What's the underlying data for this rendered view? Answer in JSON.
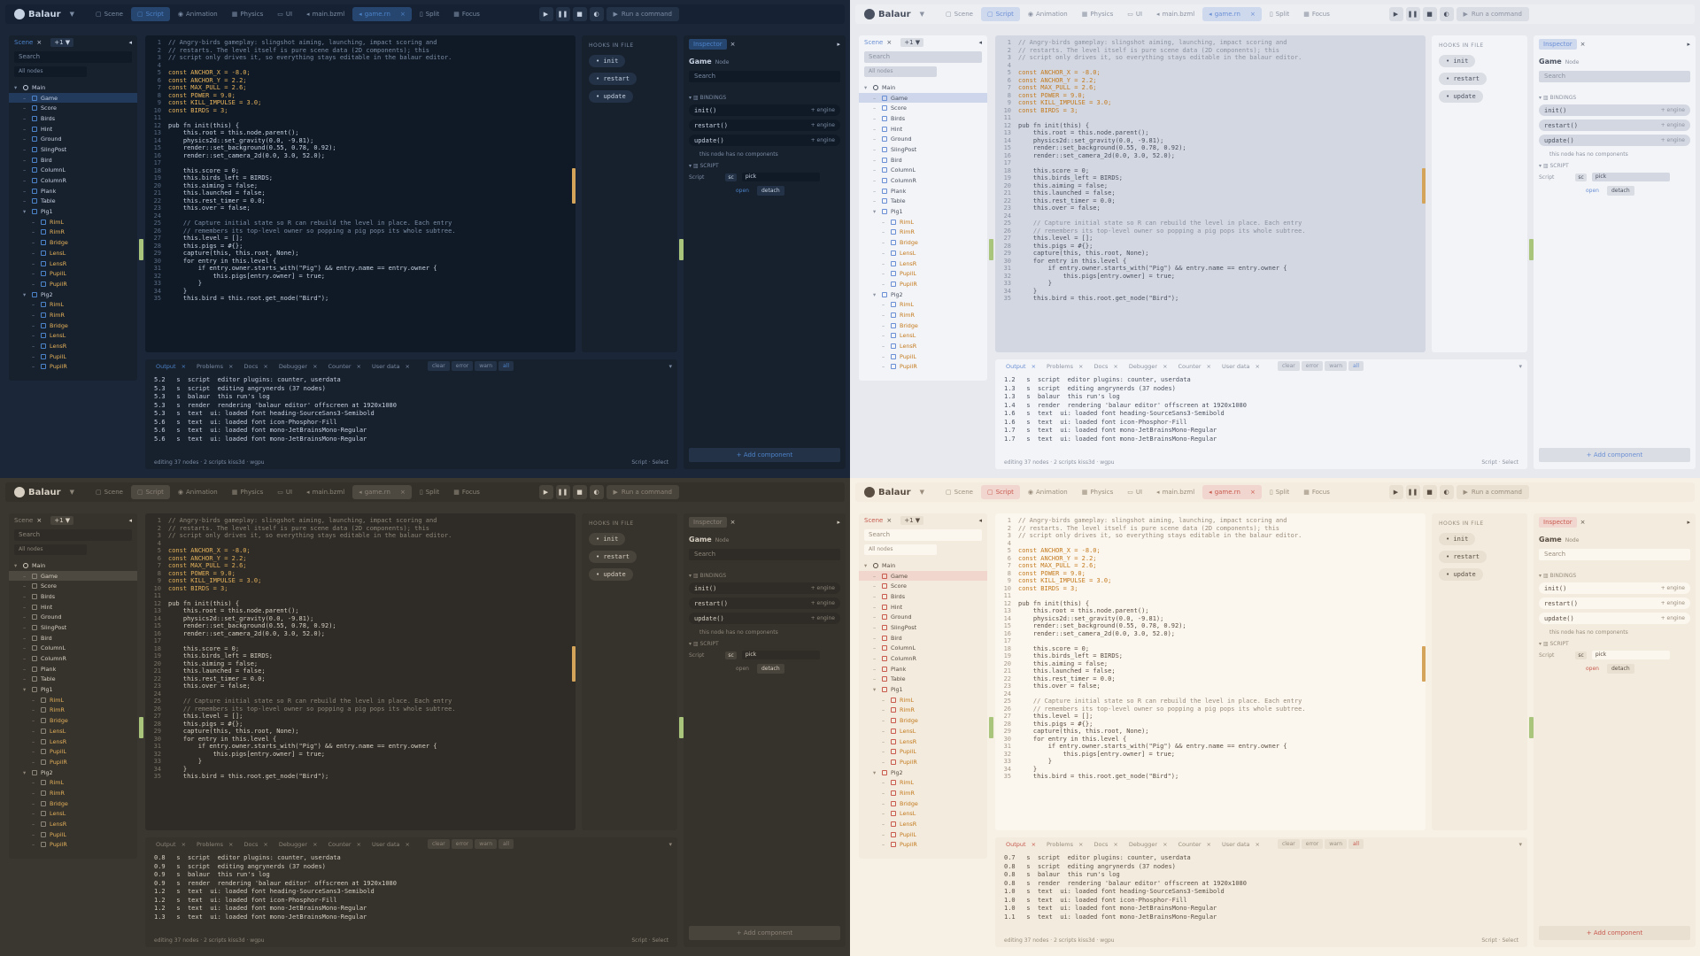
{
  "app": {
    "title": "Balaur",
    "menu": "▼"
  },
  "tabs": [
    {
      "icon": "▢",
      "label": "Scene"
    },
    {
      "icon": "▢",
      "label": "Script"
    },
    {
      "icon": "◉",
      "label": "Animation"
    },
    {
      "icon": "▦",
      "label": "Physics"
    },
    {
      "icon": "▭",
      "label": "UI"
    },
    {
      "icon": "◂",
      "label": "main.bzml"
    },
    {
      "icon": "◂",
      "label": "game.rn",
      "close": "×"
    },
    {
      "icon": "▯",
      "label": "Split"
    },
    {
      "icon": "▦",
      "label": "Focus"
    }
  ],
  "controls": {
    "play": "▶",
    "pause": "❚❚",
    "stop": "■",
    "theme": "◐",
    "run": "Run a command"
  },
  "left": {
    "tab": "Scene",
    "close": "×",
    "level": "+1 ▼",
    "collapse": "◂",
    "search": "Search",
    "filter": "All nodes"
  },
  "tree": [
    {
      "d": 0,
      "n": "Main"
    },
    {
      "d": 1,
      "n": "Game",
      "sel": true
    },
    {
      "d": 1,
      "n": "Score"
    },
    {
      "d": 1,
      "n": "Birds"
    },
    {
      "d": 1,
      "n": "Hint"
    },
    {
      "d": 1,
      "n": "Ground"
    },
    {
      "d": 1,
      "n": "SlingPost"
    },
    {
      "d": 1,
      "n": "Bird"
    },
    {
      "d": 1,
      "n": "ColumnL"
    },
    {
      "d": 1,
      "n": "ColumnR"
    },
    {
      "d": 1,
      "n": "Plank"
    },
    {
      "d": 1,
      "n": "Table"
    },
    {
      "d": 1,
      "n": "Pig1"
    },
    {
      "d": 2,
      "n": "RimL"
    },
    {
      "d": 2,
      "n": "RimR"
    },
    {
      "d": 2,
      "n": "Bridge"
    },
    {
      "d": 2,
      "n": "LensL"
    },
    {
      "d": 2,
      "n": "LensR"
    },
    {
      "d": 2,
      "n": "PupilL"
    },
    {
      "d": 2,
      "n": "PupilR"
    },
    {
      "d": 1,
      "n": "Pig2"
    },
    {
      "d": 2,
      "n": "RimL"
    },
    {
      "d": 2,
      "n": "RimR"
    },
    {
      "d": 2,
      "n": "Bridge"
    },
    {
      "d": 2,
      "n": "LensL"
    },
    {
      "d": 2,
      "n": "LensR"
    },
    {
      "d": 2,
      "n": "PupilL"
    },
    {
      "d": 2,
      "n": "PupilR"
    }
  ],
  "code": [
    "// Angry-birds gameplay: slingshot aiming, launching, impact scoring and",
    "// restarts. The level itself is pure scene data (2D components); this",
    "// script only drives it, so everything stays editable in the balaur editor.",
    "",
    "const ANCHOR_X = -8.0;",
    "const ANCHOR_Y = 2.2;",
    "const MAX_PULL = 2.6;",
    "const POWER = 9.0;",
    "const KILL_IMPULSE = 3.0;",
    "const BIRDS = 3;",
    "",
    "pub fn init(this) {",
    "    this.root = this.node.parent();",
    "    physics2d::set_gravity(0.0, -9.81);",
    "    render::set_background(0.55, 0.78, 0.92);",
    "    render::set_camera_2d(0.0, 3.0, 52.0);",
    "",
    "    this.score = 0;",
    "    this.birds_left = BIRDS;",
    "    this.aiming = false;",
    "    this.launched = false;",
    "    this.rest_timer = 0.0;",
    "    this.over = false;",
    "",
    "    // Capture initial state so R can rebuild the level in place. Each entry",
    "    // remembers its top-level owner so popping a pig pops its whole subtree.",
    "    this.level = [];",
    "    this.pigs = #{};",
    "    capture(this, this.root, None);",
    "    for entry in this.level {",
    "        if entry.owner.starts_with(\"Pig\") && entry.name == entry.owner {",
    "            this.pigs[entry.owner] = true;",
    "        }",
    "    }",
    "    this.bird = this.root.get_node(\"Bird\");"
  ],
  "hooks": {
    "title": "HOOKS IN FILE",
    "items": [
      "init",
      "restart",
      "update"
    ]
  },
  "inspector": {
    "tab": "Inspector",
    "close": "×",
    "title": "Game",
    "kind": "Node",
    "search": "Search",
    "bindings": "BINDINGS",
    "binds": [
      {
        "fn": "init()",
        "src": "+ engine"
      },
      {
        "fn": "restart()",
        "src": "+ engine"
      },
      {
        "fn": "update()",
        "src": "+ engine"
      }
    ],
    "nocomp": "this node has no components",
    "script": "SCRIPT",
    "script_label": "Script",
    "sc": "sc",
    "pick": "pick",
    "open": "open",
    "detach": "detach",
    "add": "+ Add component"
  },
  "output": {
    "tabs": [
      "Output",
      "Problems",
      "Docs",
      "Debugger",
      "Counter",
      "User data"
    ],
    "filters": [
      "clear",
      "error",
      "warn",
      "all"
    ],
    "footer_left": "editing 37 nodes · 2 scripts kiss3d · wgpu",
    "footer_right": "Script · Select"
  },
  "logs": [
    {
      "t": [
        "5.2",
        "5.3",
        "5.3",
        "5.3",
        "5.3",
        "5.6",
        "5.6",
        "5.6"
      ]
    },
    {
      "t": [
        "1.2",
        "1.3",
        "1.3",
        "1.4",
        "1.6",
        "1.6",
        "1.7",
        "1.7"
      ]
    },
    {
      "t": [
        "0.8",
        "0.9",
        "0.9",
        "0.9",
        "1.2",
        "1.2",
        "1.2",
        "1.3"
      ]
    },
    {
      "t": [
        "0.7",
        "0.8",
        "0.8",
        "0.8",
        "1.0",
        "1.0",
        "1.0",
        "1.1"
      ]
    }
  ],
  "log_lines": [
    "s  script  editor plugins: counter, userdata",
    "s  script  editing angrynerds (37 nodes)",
    "s  balaur  this run's log",
    "s  render  rendering 'balaur editor' offscreen at 1920x1080",
    "s  text  ui: loaded font heading-SourceSans3-Semibold",
    "s  text  ui: loaded font icon-Phosphor-Fill",
    "s  text  ui: loaded font mono-JetBrainsMono-Regular",
    "s  text  ui: loaded font mono-JetBrainsMono-Regular"
  ],
  "colors": {
    "blue": "#1b2738",
    "light": "#e7e9ee",
    "brown": "#3a3630",
    "cream": "#f6f0e5"
  }
}
